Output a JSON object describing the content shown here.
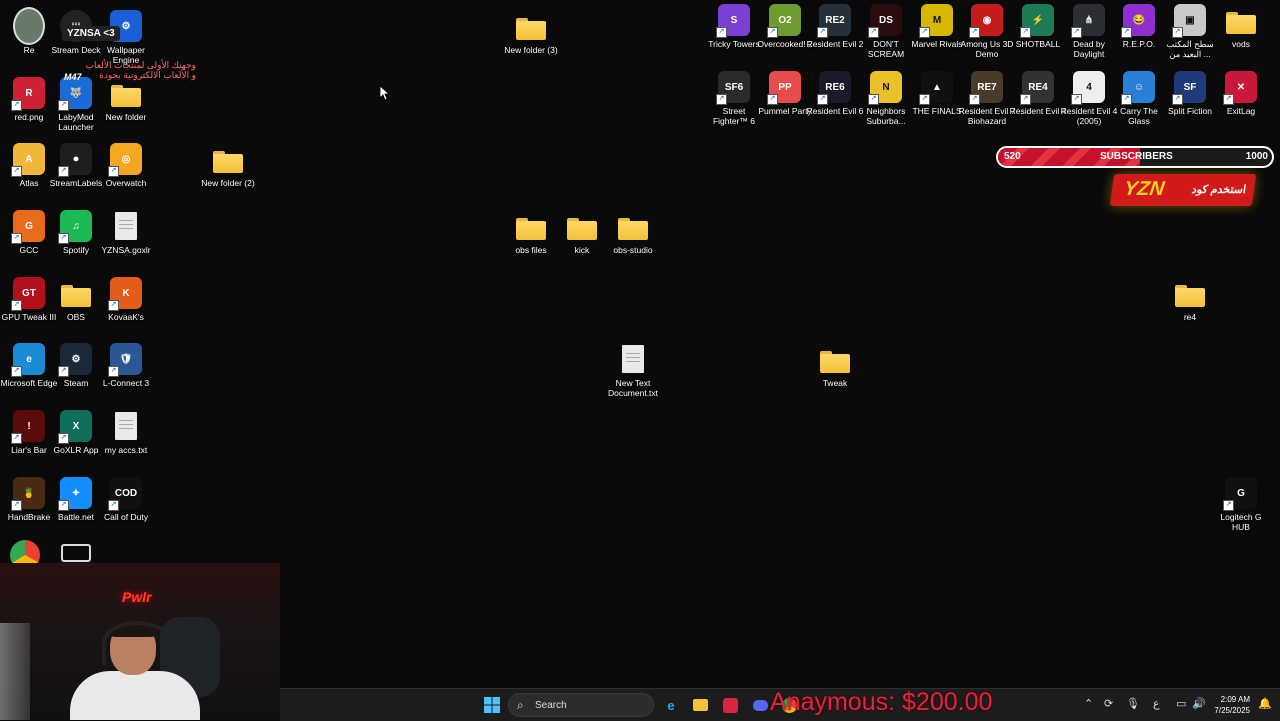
{
  "desktop_icons_left": [
    {
      "name": "red.png",
      "glyph": "R",
      "color": "#c23"
    },
    {
      "name": "LabyMod Launcher",
      "glyph": "🐺",
      "color": "#1a6bd6"
    },
    {
      "name": "New folder",
      "glyph": "folder"
    },
    {
      "name": "Atlas",
      "glyph": "A",
      "color": "#f0b73a"
    },
    {
      "name": "StreamLabels",
      "glyph": "⏺",
      "color": "#1e1e1e"
    },
    {
      "name": "Overwatch",
      "glyph": "◎",
      "color": "#f5a623"
    },
    {
      "name": "New folder (2)",
      "glyph": "folder"
    },
    {
      "name": "GCC",
      "glyph": "G",
      "color": "#e86a1a"
    },
    {
      "name": "Spotify",
      "glyph": "♫",
      "color": "#1db954"
    },
    {
      "name": "YZNSA.goxlr",
      "glyph": "doc"
    },
    {
      "name": "GPU Tweak III",
      "glyph": "GT",
      "color": "#b2101b"
    },
    {
      "name": "OBS",
      "glyph": "folder"
    },
    {
      "name": "KovaaK's",
      "glyph": "K",
      "color": "#e45c1a"
    },
    {
      "name": "Microsoft Edge",
      "glyph": "e",
      "color": "#1b8bd8"
    },
    {
      "name": "Steam",
      "glyph": "⚙",
      "color": "#1b2838"
    },
    {
      "name": "L-Connect 3",
      "glyph": "🛡",
      "color": "#2b5797"
    },
    {
      "name": "Liar's Bar",
      "glyph": "!",
      "color": "#5a0b0b"
    },
    {
      "name": "GoXLR App",
      "glyph": "X",
      "color": "#0f6f5a"
    },
    {
      "name": "my accs.txt",
      "glyph": "doc"
    },
    {
      "name": "HandBrake",
      "glyph": "🍍",
      "color": "#4a2a12"
    },
    {
      "name": "Battle.net",
      "glyph": "✦",
      "color": "#148eff"
    },
    {
      "name": "Call of Duty",
      "glyph": "COD",
      "color": "#111"
    }
  ],
  "top_row_labels": {
    "wallpaper": "Wallpaper Engine",
    "steamdeck": "Stream Deck",
    "recycle": "Re"
  },
  "desktop_icons_middle": [
    {
      "name": "New folder (3)",
      "glyph": "folder"
    },
    {
      "name": "obs files",
      "glyph": "folder"
    },
    {
      "name": "kick",
      "glyph": "folder"
    },
    {
      "name": "obs-studio",
      "glyph": "folder"
    },
    {
      "name": "New Text Document.txt",
      "glyph": "doc"
    },
    {
      "name": "Tweak",
      "glyph": "folder"
    }
  ],
  "desktop_icons_right_row1": [
    {
      "name": "Tricky Towers",
      "glyph": "S",
      "color": "#7b3fd1"
    },
    {
      "name": "Overcooked! 2",
      "glyph": "O2",
      "color": "#6c9b2f"
    },
    {
      "name": "Resident Evil 2",
      "glyph": "RE2",
      "color": "#25313a"
    },
    {
      "name": "DON'T SCREAM",
      "glyph": "DS",
      "color": "#2a0d0d"
    },
    {
      "name": "Marvel Rivals",
      "glyph": "M",
      "color": "#d7b700"
    },
    {
      "name": "Among Us 3D Demo",
      "glyph": "◉",
      "color": "#c41b1b"
    },
    {
      "name": "SHOTBALL",
      "glyph": "⚡",
      "color": "#1d7b55"
    },
    {
      "name": "Dead by Daylight",
      "glyph": "⋔",
      "color": "#2b2f33"
    },
    {
      "name": "R.E.P.O.",
      "glyph": "😂",
      "color": "#8f2fd0"
    },
    {
      "name": "سطح المكتب البعيد من ...",
      "glyph": "▣",
      "color": "#c9c9c9"
    },
    {
      "name": "vods",
      "glyph": "folder"
    }
  ],
  "desktop_icons_right_row2": [
    {
      "name": "Street Fighter™ 6",
      "glyph": "SF6",
      "color": "#2a2a2a"
    },
    {
      "name": "Pummel Party",
      "glyph": "PP",
      "color": "#e64c4c"
    },
    {
      "name": "Resident Evil 6",
      "glyph": "RE6",
      "color": "#1a1a2a"
    },
    {
      "name": "Neighbors Suburba...",
      "glyph": "N",
      "color": "#e9c22a"
    },
    {
      "name": "THE FINALS",
      "glyph": "▲",
      "color": "#111"
    },
    {
      "name": "Resident Evil 7 Biohazard",
      "glyph": "RE7",
      "color": "#4a3a2a"
    },
    {
      "name": "Resident Evil 4",
      "glyph": "RE4",
      "color": "#333"
    },
    {
      "name": "Resident Evil 4 (2005)",
      "glyph": "4",
      "color": "#eee"
    },
    {
      "name": "Carry The Glass",
      "glyph": "☺",
      "color": "#2a7fd6"
    },
    {
      "name": "Split Fiction",
      "glyph": "SF",
      "color": "#1e3a7a"
    },
    {
      "name": "ExitLag",
      "glyph": "✕",
      "color": "#c9183a"
    }
  ],
  "desktop_icons_right_extra": [
    {
      "name": "re4",
      "glyph": "folder"
    },
    {
      "name": "Logitech G HUB",
      "glyph": "G",
      "color": "#111"
    }
  ],
  "overlay": {
    "streamer_tag": "YZNSA <3",
    "arabic_line1": "وجهتك الأولى لمنتجات الألعاب",
    "arabic_line2": "و الألعاب الالكترونية بجودة",
    "m47": "M47",
    "subscribers_label": "SUBSCRIBERS",
    "subscribers_current": "520",
    "subscribers_goal": "1000",
    "subscribers_progress_fraction": 0.52,
    "promo_code": "YZN",
    "promo_word": "استخدم كود",
    "donation": "Anaymous: $200.00",
    "webcam_neon": "Pwlr"
  },
  "taskbar": {
    "search_placeholder": "Search",
    "time": "2:09 AM",
    "date": "7/25/2025",
    "lang": "ع"
  }
}
